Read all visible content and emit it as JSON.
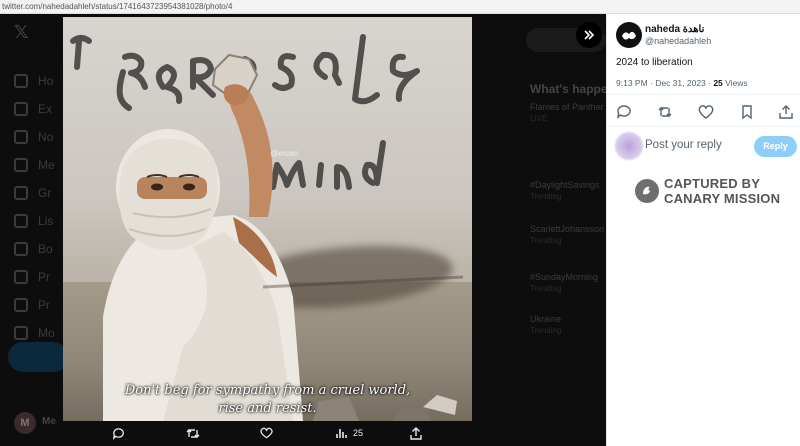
{
  "browser": {
    "url": "twitter.com/nahedadahleh/status/1741643723954381028/photo/4"
  },
  "bg_nav": {
    "items": [
      "Ho",
      "Ex",
      "No",
      "Me",
      "Gr",
      "Lis",
      "Bo",
      "Pr",
      "Pr",
      "Mo"
    ],
    "user_initial": "M",
    "user_name": "Me"
  },
  "bg_trends": {
    "heading": "What's happe",
    "items": [
      {
        "title": "Flames of Panther",
        "sub": "LIVE"
      },
      {
        "title": "#DaylightSavings",
        "sub": "Trending"
      },
      {
        "title": "ScarlettJohansson",
        "sub": "Trending"
      },
      {
        "title": "#SundayMorning",
        "sub": "Trending"
      },
      {
        "title": "Ukraine",
        "sub": "Trending"
      }
    ]
  },
  "photo": {
    "watermark": "@ercan",
    "subtitle_line1": "Don't beg for sympathy from a cruel world,",
    "subtitle_line2": "rise and resist."
  },
  "viewer_actions": {
    "views": "25"
  },
  "tweet": {
    "display_name": "naheda ناهدة",
    "handle": "@nahedadahleh",
    "text": "2024 to liberation",
    "time": "9:13 PM · Dec 31, 2023 · ",
    "views": "25",
    "views_label": " Views"
  },
  "reply": {
    "placeholder": "Post your reply",
    "button": "Reply"
  },
  "overlay": {
    "line1": "CAPTURED BY",
    "line2": "CANARY MISSION"
  },
  "colors": {
    "accent": "#1d9bf0",
    "reply_button": "#8ecdf8",
    "overlay_gray": "#555555"
  }
}
